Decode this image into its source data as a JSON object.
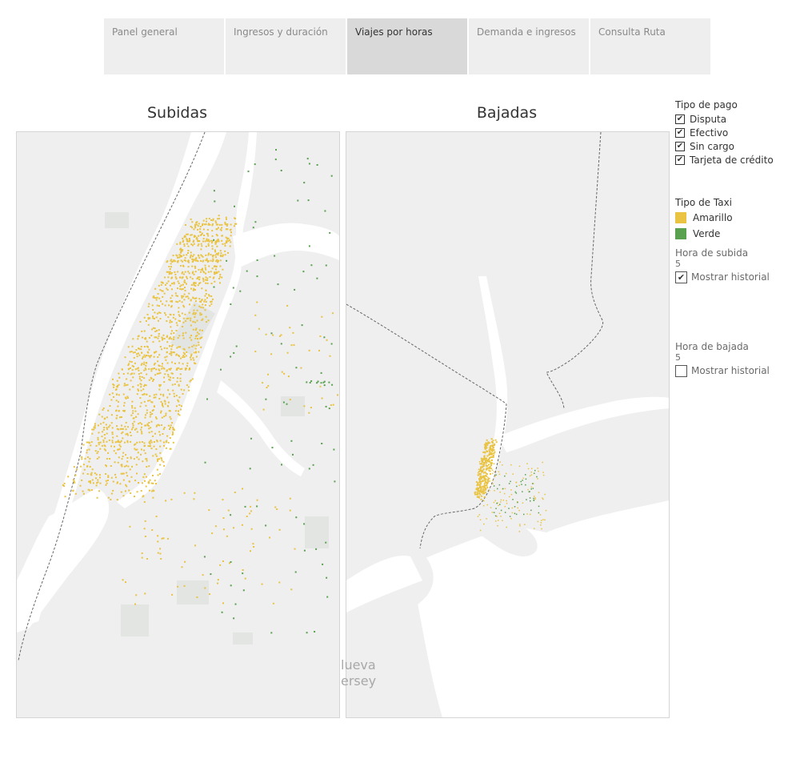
{
  "tabs": [
    {
      "label": "Panel general",
      "active": false
    },
    {
      "label": "Ingresos y duración",
      "active": false
    },
    {
      "label": "Viajes por horas",
      "active": true
    },
    {
      "label": "Demanda e ingresos",
      "active": false
    },
    {
      "label": "Consulta Ruta",
      "active": false
    }
  ],
  "maps": {
    "pickups": {
      "title": "Subidas"
    },
    "dropoffs": {
      "title": "Bajadas",
      "region_label_line1": "lueva",
      "region_label_line2": "ersey"
    }
  },
  "payment_filter": {
    "title": "Tipo de pago",
    "options": [
      {
        "label": "Disputa",
        "checked": true
      },
      {
        "label": "Efectivo",
        "checked": true
      },
      {
        "label": "Sin cargo",
        "checked": true
      },
      {
        "label": "Tarjeta de crédito",
        "checked": true
      }
    ]
  },
  "taxi_legend": {
    "title": "Tipo de Taxi",
    "items": [
      {
        "label": "Amarillo",
        "color": "#e9c341"
      },
      {
        "label": "Verde",
        "color": "#59a14f"
      }
    ]
  },
  "pickup_hour": {
    "label": "Hora de subida",
    "value": "5",
    "history_label": "Mostrar historial",
    "history_checked": true
  },
  "dropoff_hour": {
    "label": "Hora de bajada",
    "value": "5",
    "history_label": "Mostrar historial",
    "history_checked": false
  },
  "colors": {
    "water": "#ffffff",
    "land": "#efefef",
    "park": "#e2e5e2",
    "yellow": "#e9c341",
    "green": "#59a14f"
  }
}
